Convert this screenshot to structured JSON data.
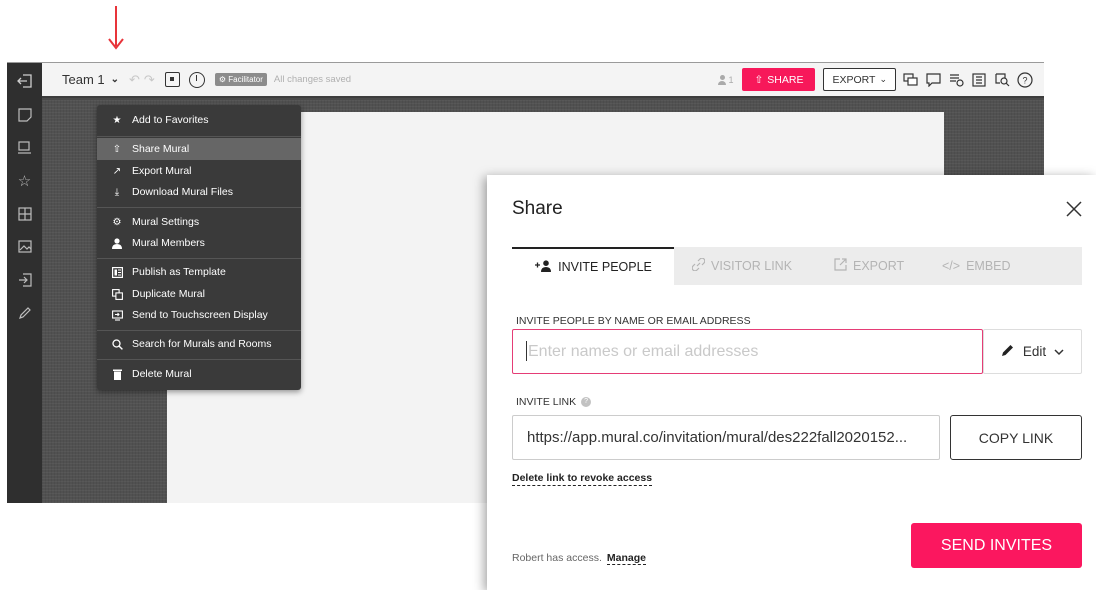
{
  "colors": {
    "accent": "#f7185a",
    "annotation_arrow": "#e8343a",
    "menu_bg": "#3a3a3a",
    "sidebar_bg": "#2f2f2f"
  },
  "toolbar": {
    "team_name": "Team 1",
    "team_chevron_icon": "chevron-down-icon",
    "facilitator_badge": "Facilitator",
    "save_status": "All changes saved",
    "user_count": "1",
    "share_label": "SHARE",
    "export_label": "EXPORT",
    "right_tools": [
      "comment-icon",
      "chat-icon",
      "activity-icon",
      "outline-icon",
      "search-icon",
      "help-icon"
    ]
  },
  "sidebar": {
    "items": [
      "exit-icon",
      "sticky-note-icon",
      "shapes-icon",
      "favorites-icon",
      "frameworks-icon",
      "images-icon",
      "import-icon",
      "draw-icon"
    ]
  },
  "menu": {
    "items": [
      {
        "label": "Add to Favorites",
        "icon": "star-icon"
      },
      {
        "label": "Share Mural",
        "icon": "share-icon",
        "active": true
      },
      {
        "label": "Export Mural",
        "icon": "export-icon"
      },
      {
        "label": "Download Mural Files",
        "icon": "download-icon"
      },
      {
        "label": "Mural Settings",
        "icon": "gear-icon"
      },
      {
        "label": "Mural Members",
        "icon": "person-icon"
      },
      {
        "label": "Publish as Template",
        "icon": "template-icon"
      },
      {
        "label": "Duplicate Mural",
        "icon": "duplicate-icon"
      },
      {
        "label": "Send to Touchscreen Display",
        "icon": "display-icon"
      },
      {
        "label": "Search for Murals and Rooms",
        "icon": "search-icon"
      },
      {
        "label": "Delete Mural",
        "icon": "trash-icon"
      }
    ]
  },
  "modal": {
    "title": "Share",
    "tabs": [
      {
        "label": "INVITE PEOPLE",
        "icon": "add-person-icon",
        "active": true
      },
      {
        "label": "VISITOR LINK",
        "icon": "link-icon"
      },
      {
        "label": "EXPORT",
        "icon": "export-icon"
      },
      {
        "label": "EMBED",
        "icon": "code-icon"
      }
    ],
    "invite_label": "INVITE PEOPLE BY NAME OR EMAIL ADDRESS",
    "invite_placeholder": "Enter names or email addresses",
    "permission_label": "Edit",
    "invite_link_label": "INVITE LINK",
    "invite_link_value": "https://app.mural.co/invitation/mural/des222fall2020152...",
    "copy_link_label": "COPY LINK",
    "revoke_label": "Delete link to revoke access",
    "access_text": "Robert has access.",
    "manage_label": "Manage",
    "send_label": "SEND INVITES"
  }
}
